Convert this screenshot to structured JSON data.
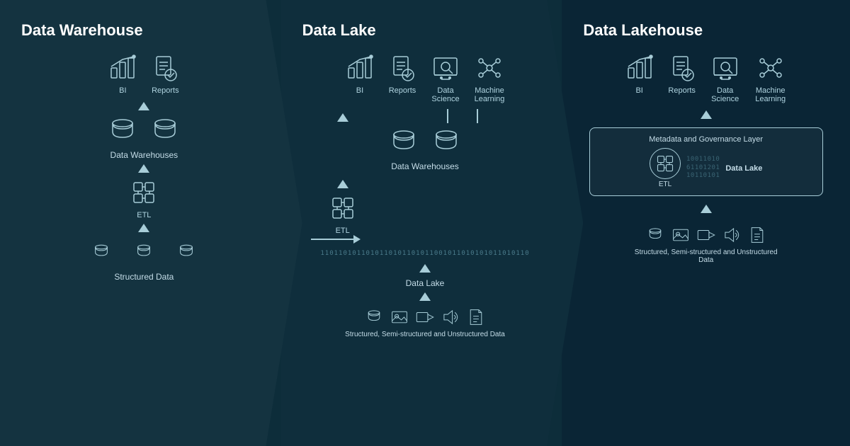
{
  "warehouse": {
    "title": "Data Warehouse",
    "top_icons": [
      {
        "label": "BI",
        "type": "bi"
      },
      {
        "label": "Reports",
        "type": "reports"
      }
    ],
    "mid_label": "Data Warehouses",
    "etl_label": "ETL",
    "bottom_label": "Structured Data"
  },
  "lake": {
    "title": "Data Lake",
    "top_icons": [
      {
        "label": "BI",
        "type": "bi"
      },
      {
        "label": "Reports",
        "type": "reports"
      },
      {
        "label": "Data Science",
        "type": "datascience"
      },
      {
        "label": "Machine Learning",
        "type": "ml"
      }
    ],
    "mid_label": "Data Warehouses",
    "etl_label": "ETL",
    "datalake_label": "Data Lake",
    "bottom_label": "Structured, Semi-structured and Unstructured Data",
    "binary": "1101101011010110101101011"
  },
  "lakehouse": {
    "title": "Data Lakehouse",
    "top_icons": [
      {
        "label": "BI",
        "type": "bi"
      },
      {
        "label": "Reports",
        "type": "reports"
      },
      {
        "label": "Data Science",
        "type": "datascience"
      },
      {
        "label": "Machine Learning",
        "type": "ml"
      }
    ],
    "governance_title": "Metadata and Governance Layer",
    "datalake_label": "Data Lake",
    "binary": "10011010611012",
    "bottom_label": "Structured, Semi-structured and Unstructured Data",
    "etl_label": "ETL"
  }
}
